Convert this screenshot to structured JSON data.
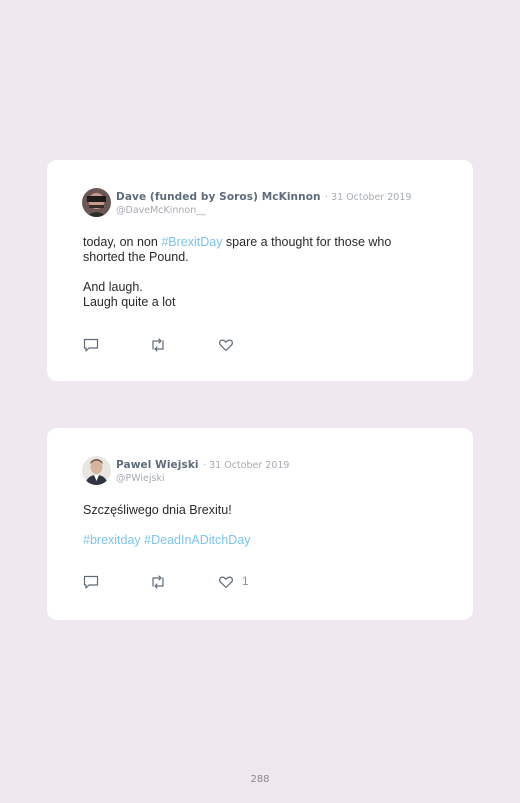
{
  "tweets": [
    {
      "author_name": "Dave (funded by Soros) McKinnon",
      "date": "· 31 October 2019",
      "handle": "@DaveMcKinnon__",
      "text_before_tag": "today, on non ",
      "hashtag": "#BrexitDay",
      "text_after_tag": " spare a thought for those who shorted the Pound.",
      "line2": "And laugh.",
      "line3": "Laugh quite a lot",
      "like_count": ""
    },
    {
      "author_name": "Pawel Wiejski",
      "date": "· 31 October 2019",
      "handle": "@PWiejski",
      "text": "Szczęśliwego dnia Brexitu!",
      "hashtags": "#brexitday #DeadInADitchDay",
      "like_count": "1"
    }
  ],
  "icons": {
    "reply": "reply-icon",
    "retweet": "retweet-icon",
    "like": "heart-icon"
  },
  "colors": {
    "background": "#efe8ee",
    "card": "#ffffff",
    "hashtag": "#7ec3e9",
    "name": "#5d6b7a",
    "muted": "#a6acb3"
  },
  "page_number": "288"
}
